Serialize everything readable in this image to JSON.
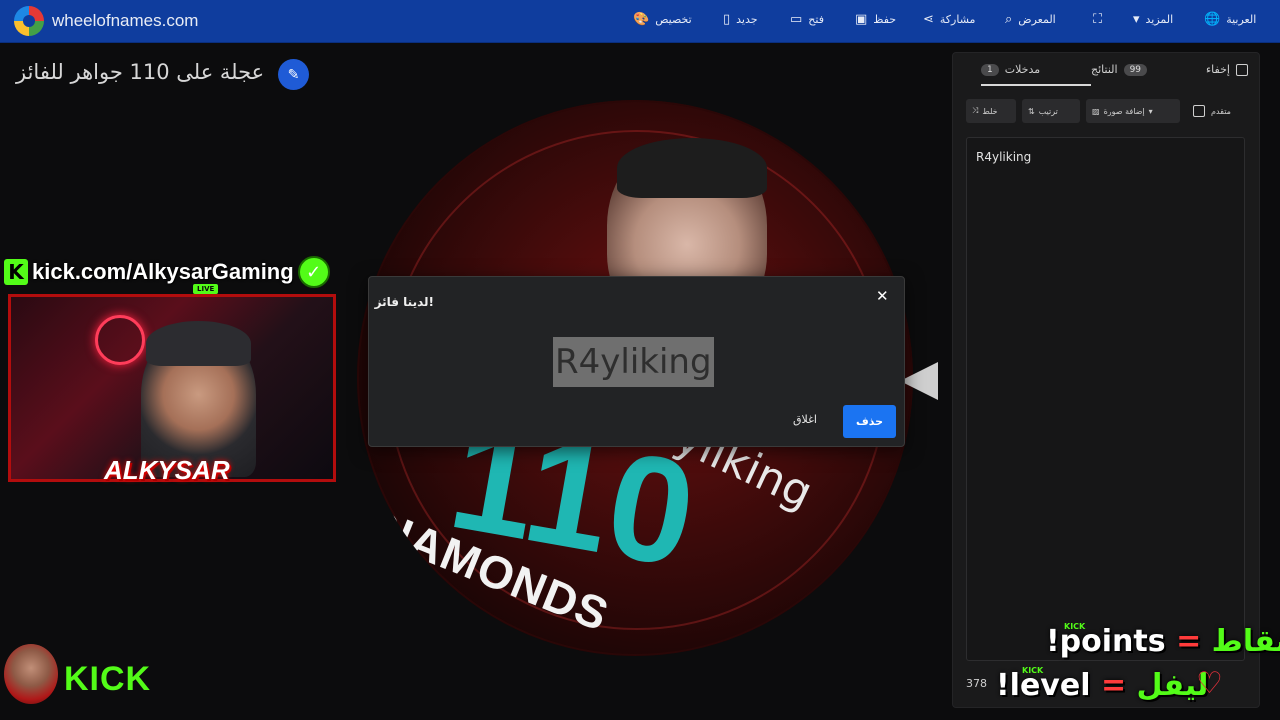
{
  "header": {
    "site": "wheelofnames.com",
    "menu": [
      {
        "label": "تخصيص",
        "icon": "palette-icon"
      },
      {
        "label": "جديد",
        "icon": "file-icon"
      },
      {
        "label": "فتح",
        "icon": "folder-icon"
      },
      {
        "label": "حفظ",
        "icon": "save-icon"
      },
      {
        "label": "مشاركة",
        "icon": "share-icon"
      },
      {
        "label": "المعرض",
        "icon": "search-icon"
      },
      {
        "label": "",
        "icon": "fullscreen-icon"
      },
      {
        "label": "المزيد",
        "icon": "caret-down-icon"
      },
      {
        "label": "العربية",
        "icon": "globe-icon"
      }
    ]
  },
  "title": "عجلة على 110 جواهر للفائز",
  "wheel": {
    "text_number": "110",
    "text_diamonds": "DIAMONDS",
    "segment_label": "yliking"
  },
  "dialog": {
    "title": "لدينا فائز!",
    "winner": "R4yliking",
    "close_label": "اغلاق",
    "remove_label": "حذف"
  },
  "panel": {
    "tab_entries": "مدخلات",
    "tab_entries_count": "1",
    "tab_results": "النتائج",
    "tab_results_count": "99",
    "hide_label": "إخفاء",
    "advanced_label": "متقدم",
    "add_image_label": "إضافة صورة",
    "sort_label": "ترتيب",
    "shuffle_label": "خلط",
    "entries": [
      "R4yliking"
    ],
    "count": "378"
  },
  "overlay": {
    "kick_url": "kick.com/AlkysarGaming",
    "live": "LIVE",
    "streamer_name": "ALKYSAR",
    "kick_logo": "KICK",
    "cmd_points_ar": "نقاط",
    "cmd_points_en": "!points",
    "cmd_level_ar": "ليفل",
    "cmd_level_en": "!level",
    "equals": "=",
    "mini_kick": "KICK"
  },
  "colors": {
    "topbar": "#0f3d9e",
    "primary_button": "#1b74f2",
    "kick_green": "#53fc18",
    "wheel_teal": "#1fb7b3"
  }
}
